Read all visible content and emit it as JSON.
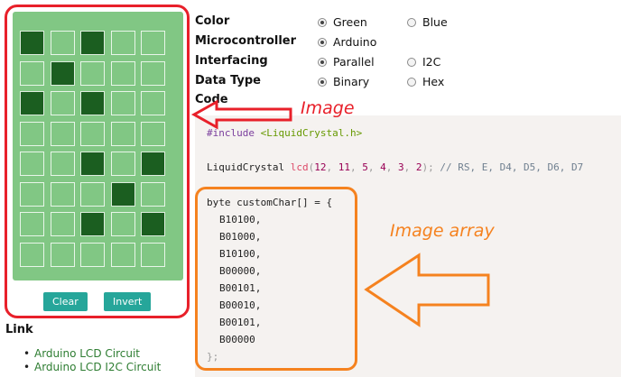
{
  "options": {
    "color": {
      "label": "Color",
      "choices": [
        "Green",
        "Blue"
      ],
      "selected": 0
    },
    "microcontroller": {
      "label": "Microcontroller",
      "choices": [
        "Arduino"
      ],
      "selected": 0
    },
    "interfacing": {
      "label": "Interfacing",
      "choices": [
        "Parallel",
        "I2C"
      ],
      "selected": 0
    },
    "data_type": {
      "label": "Data Type",
      "choices": [
        "Binary",
        "Hex"
      ],
      "selected": 0
    }
  },
  "code_label": "Code",
  "grid": {
    "rows": [
      [
        1,
        0,
        1,
        0,
        0
      ],
      [
        0,
        1,
        0,
        0,
        0
      ],
      [
        1,
        0,
        1,
        0,
        0
      ],
      [
        0,
        0,
        0,
        0,
        0
      ],
      [
        0,
        0,
        1,
        0,
        1
      ],
      [
        0,
        0,
        0,
        1,
        0
      ],
      [
        0,
        0,
        1,
        0,
        1
      ],
      [
        0,
        0,
        0,
        0,
        0
      ]
    ]
  },
  "buttons": {
    "clear": "Clear",
    "invert": "Invert"
  },
  "links": {
    "heading": "Link",
    "items": [
      "Arduino LCD Circuit",
      "Arduino LCD I2C Circuit"
    ]
  },
  "code": {
    "include_directive": "#include",
    "include_file": "<LiquidCrystal.h>",
    "lcd_type": "LiquidCrystal",
    "lcd_call": "lcd",
    "lcd_args": [
      "12",
      "11",
      "5",
      "4",
      "3",
      "2"
    ],
    "lcd_comment": "// RS, E, D4, D5, D6, D7",
    "array_decl": "byte customChar[] = {",
    "array_values": [
      "B10100,",
      "B01000,",
      "B10100,",
      "B00000,",
      "B00101,",
      "B00010,",
      "B00101,",
      "B00000"
    ],
    "array_close": "};"
  },
  "annotations": {
    "image": "Image",
    "image_array": "Image array",
    "colors": {
      "red": "#e8202a",
      "orange": "#f5821f"
    }
  },
  "colors": {
    "panel": "#81c784",
    "pixel_on": "#1b5e20",
    "button": "#26a69a",
    "code_bg": "#f5f2f0"
  }
}
